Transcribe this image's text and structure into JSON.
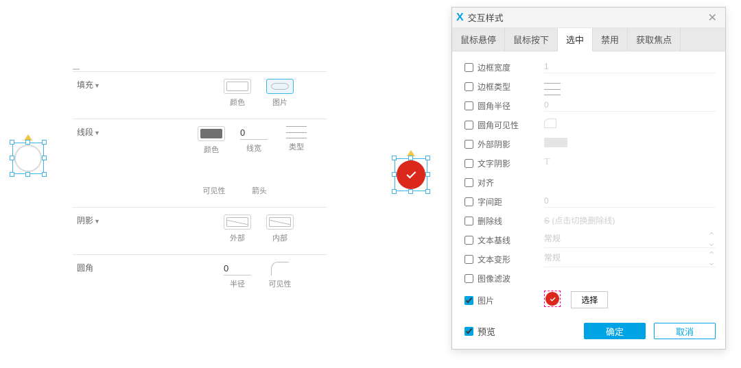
{
  "props": {
    "fill": {
      "label": "填充",
      "color_cap": "颜色",
      "image_cap": "图片"
    },
    "stroke": {
      "label": "线段",
      "color_cap": "颜色",
      "width_value": "0",
      "width_cap": "线宽",
      "type_cap": "类型",
      "visible_cap": "可见性",
      "arrow_cap": "箭头"
    },
    "shadow": {
      "label": "阴影",
      "outer_cap": "外部",
      "inner_cap": "内部"
    },
    "corner": {
      "label": "圆角",
      "radius_value": "0",
      "radius_cap": "半径",
      "visible_cap": "可见性"
    }
  },
  "dialog": {
    "title": "交互样式",
    "tabs": {
      "hover": "鼠标悬停",
      "down": "鼠标按下",
      "selected": "选中",
      "disabled": "禁用",
      "focus": "获取焦点"
    },
    "options": {
      "border_width": {
        "label": "边框宽度",
        "value": "1"
      },
      "border_type": {
        "label": "边框类型"
      },
      "corner_radius": {
        "label": "圆角半径",
        "value": "0"
      },
      "corner_vis": {
        "label": "圆角可见性"
      },
      "outer_shadow": {
        "label": "外部阴影"
      },
      "text_shadow": {
        "label": "文字阴影",
        "placeholder": "T"
      },
      "align": {
        "label": "对齐"
      },
      "letter_spacing": {
        "label": "字间距",
        "value": "0"
      },
      "strike": {
        "label": "删除线",
        "hint": "(点击切换删除线)"
      },
      "baseline": {
        "label": "文本基线",
        "value": "常规"
      },
      "transform": {
        "label": "文本变形",
        "value": "常规"
      },
      "image_filter": {
        "label": "图像滤波"
      },
      "image": {
        "label": "图片",
        "select_btn": "选择"
      }
    },
    "preview_label": "预览",
    "ok": "确定",
    "cancel": "取消"
  }
}
